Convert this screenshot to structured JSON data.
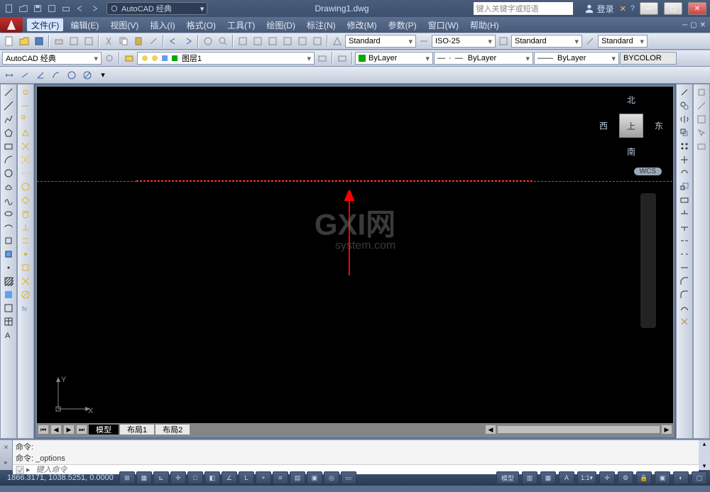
{
  "title": "Drawing1.dwg",
  "workspace": "AutoCAD 经典",
  "search_placeholder": "键入关键字或短语",
  "login": "登录",
  "menu": {
    "file": "文件(F)",
    "edit": "编辑(E)",
    "view": "视图(V)",
    "insert": "插入(I)",
    "format": "格式(O)",
    "tools": "工具(T)",
    "draw": "绘图(D)",
    "dimension": "标注(N)",
    "modify": "修改(M)",
    "parametric": "参数(P)",
    "window": "窗口(W)",
    "help": "帮助(H)"
  },
  "props": {
    "style1": "Standard",
    "dimstyle": "ISO-25",
    "style2": "Standard",
    "style3": "Standard",
    "workspace_dd": "AutoCAD 经典",
    "layer": "图层1",
    "color": "ByLayer",
    "linetype": "ByLayer",
    "lineweight": "ByLayer",
    "plotstyle": "BYCOLOR"
  },
  "viewcube": {
    "n": "北",
    "s": "南",
    "e": "东",
    "w": "西",
    "top": "上"
  },
  "wcs": "WCS",
  "ucs": {
    "x": "X",
    "y": "Y"
  },
  "tabs": {
    "model": "模型",
    "layout1": "布局1",
    "layout2": "布局2"
  },
  "cmd": {
    "hist1": "命令:",
    "hist2": "命令: _options",
    "prompt": "命令:",
    "placeholder": "键入命令"
  },
  "status": {
    "coords": "1866.3171, 1038.5251, 0.0000",
    "model_btn": "模型"
  }
}
